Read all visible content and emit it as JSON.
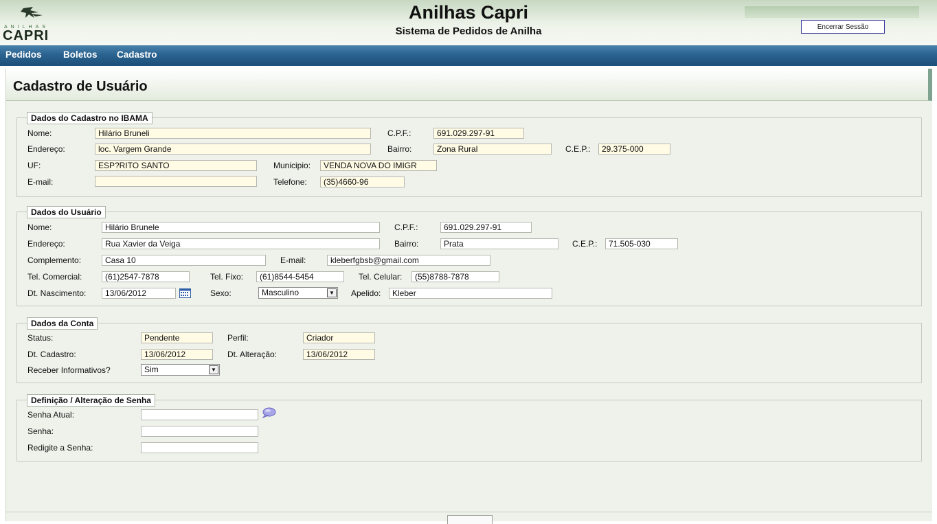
{
  "header": {
    "title": "Anilhas Capri",
    "subtitle": "Sistema de Pedidos de Anilha",
    "logo_small_text": "ANILHAS",
    "logo_text": "CAPRI",
    "logout_label": "Encerrar Sessão"
  },
  "nav": {
    "items": [
      "Pedidos",
      "Boletos",
      "Cadastro"
    ]
  },
  "page": {
    "title": "Cadastro de Usuário"
  },
  "ibama": {
    "legend": "Dados do Cadastro no IBAMA",
    "nome_label": "Nome:",
    "nome": "Hilário Bruneli",
    "cpf_label": "C.P.F.:",
    "cpf": "691.029.297-91",
    "endereco_label": "Endereço:",
    "endereco": "loc. Vargem Grande",
    "bairro_label": "Bairro:",
    "bairro": "Zona Rural",
    "cep_label": "C.E.P.:",
    "cep": "29.375-000",
    "uf_label": "UF:",
    "uf": "ESP?RITO SANTO",
    "municipio_label": "Municipio:",
    "municipio": "VENDA NOVA DO IMIGR",
    "email_label": "E-mail:",
    "email": "",
    "telefone_label": "Telefone:",
    "telefone": "(35)4660-96"
  },
  "usuario": {
    "legend": "Dados do Usuário",
    "nome_label": "Nome:",
    "nome": "Hilário Brunele",
    "cpf_label": "C.P.F.:",
    "cpf": "691.029.297-91",
    "endereco_label": "Endereço:",
    "endereco": "Rua Xavier da Veiga",
    "bairro_label": "Bairro:",
    "bairro": "Prata",
    "cep_label": "C.E.P.:",
    "cep": "71.505-030",
    "complemento_label": "Complemento:",
    "complemento": "Casa 10",
    "email_label": "E-mail:",
    "email": "kleberfgbsb@gmail.com",
    "tel_comercial_label": "Tel. Comercial:",
    "tel_comercial": "(61)2547-7878",
    "tel_fixo_label": "Tel. Fixo:",
    "tel_fixo": "(61)8544-5454",
    "tel_celular_label": "Tel. Celular:",
    "tel_celular": "(55)8788-7878",
    "dt_nascimento_label": "Dt. Nascimento:",
    "dt_nascimento": "13/06/2012",
    "sexo_label": "Sexo:",
    "sexo": "Masculino",
    "apelido_label": "Apelido:",
    "apelido": "Kleber"
  },
  "conta": {
    "legend": "Dados da Conta",
    "status_label": "Status:",
    "status": "Pendente",
    "perfil_label": "Perfil:",
    "perfil": "Criador",
    "dt_cadastro_label": "Dt. Cadastro:",
    "dt_cadastro": "13/06/2012",
    "dt_alteracao_label": "Dt. Alteração:",
    "dt_alteracao": "13/06/2012",
    "informativos_label": "Receber Informativos?",
    "informativos": "Sim"
  },
  "senha": {
    "legend": "Definição / Alteração de Senha",
    "atual_label": "Senha Atual:",
    "atual": "",
    "senha_label": "Senha:",
    "senha": "",
    "redigite_label": "Redigite a Senha:",
    "redigite": ""
  },
  "colors": {
    "nav_bg": "#2b6390",
    "readonly_field": "#fffbe5",
    "panel_bg": "#eef2ea",
    "accent_border": "#7fa291"
  }
}
